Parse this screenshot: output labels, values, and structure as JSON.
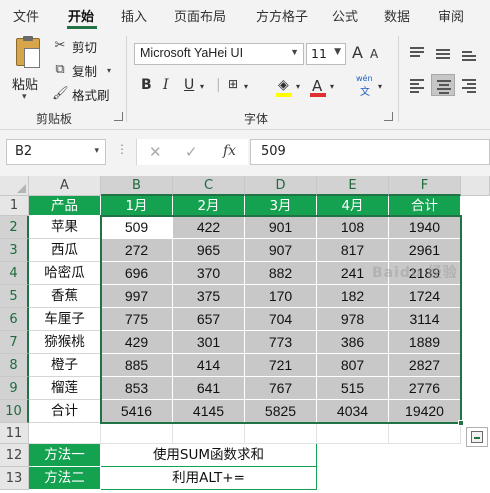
{
  "ribbon_tabs": [
    "文件",
    "开始",
    "插入",
    "页面布局",
    "方方格子",
    "公式",
    "数据",
    "审阅"
  ],
  "clipboard": {
    "paste": "粘贴",
    "cut": "剪切",
    "copy": "复制",
    "format_painter": "格式刷",
    "group_label": "剪贴板"
  },
  "font": {
    "name": "Microsoft YaHei UI",
    "size": "11",
    "bold": "B",
    "italic": "I",
    "underline": "U",
    "grow": "A",
    "shrink": "A",
    "phonetic": "wén",
    "group_label": "字体",
    "fill_color": "#ffff00",
    "font_color": "#e03030"
  },
  "formula_bar": {
    "name_box": "B2",
    "cancel_icon": "✕",
    "enter_icon": "✓",
    "fx": "fx",
    "value": "509"
  },
  "sheet": {
    "columns": [
      "A",
      "B",
      "C",
      "D",
      "E",
      "F"
    ],
    "rows": [
      "1",
      "2",
      "3",
      "4",
      "5",
      "6",
      "7",
      "8",
      "9",
      "10",
      "11",
      "12",
      "13"
    ],
    "header": [
      "产品",
      "1月",
      "2月",
      "3月",
      "4月",
      "合计"
    ],
    "data": [
      [
        "苹果",
        "509",
        "422",
        "901",
        "108",
        "1940"
      ],
      [
        "西瓜",
        "272",
        "965",
        "907",
        "817",
        "2961"
      ],
      [
        "哈密瓜",
        "696",
        "370",
        "882",
        "241",
        "2189"
      ],
      [
        "香蕉",
        "997",
        "375",
        "170",
        "182",
        "1724"
      ],
      [
        "车厘子",
        "775",
        "657",
        "704",
        "978",
        "3114"
      ],
      [
        "猕猴桃",
        "429",
        "301",
        "773",
        "386",
        "1889"
      ],
      [
        "橙子",
        "885",
        "414",
        "721",
        "807",
        "2827"
      ],
      [
        "榴莲",
        "853",
        "641",
        "767",
        "515",
        "2776"
      ],
      [
        "合计",
        "5416",
        "4145",
        "5825",
        "4034",
        "19420"
      ]
    ],
    "methods": [
      {
        "label": "方法一",
        "text": "使用SUM函数求和"
      },
      {
        "label": "方法二",
        "text": "利用ALT+="
      }
    ]
  },
  "colors": {
    "accent": "#217346",
    "header_fill": "#14a150",
    "selection_fill": "#c8c8c8"
  }
}
